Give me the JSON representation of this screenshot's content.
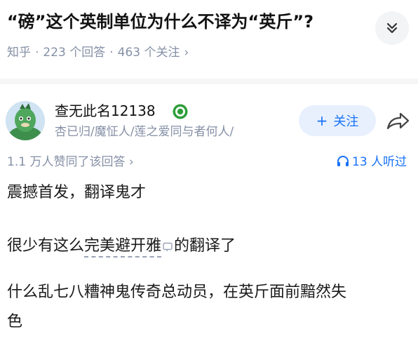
{
  "question": {
    "title": "“磅”这个英制单位为什么不译为“英斤”?",
    "platform": "知乎",
    "answers_count": "223 个回答",
    "followers_count": "463 个关注",
    "separator": "·",
    "arrow": "›"
  },
  "icons": {
    "collapse": "chevron-double-down-icon",
    "badge": "badge-icon",
    "share": "share-icon",
    "headphones": "headphones-icon",
    "comment": "comment-icon"
  },
  "author": {
    "name": "查无此名12138",
    "bio": "杏已归/魔怔人/莲之爱同与者何人/",
    "follow_plus": "+",
    "follow_label": "关注"
  },
  "stats": {
    "votes": "1.1 万人赞同了该回答",
    "votes_arrow": "›",
    "listeners": "13 人听过"
  },
  "answer": {
    "p1": "震撼首发，翻译鬼才",
    "p2_before": "很少有这么",
    "p2_link": "完美避开雅",
    "p2_after": "的翻译了",
    "p3_line1": "什么乱七八糟神鬼传奇总动员，在英斤面前黯然失",
    "p3_line2": "色"
  },
  "colors": {
    "accent": "#1772f6",
    "muted": "#8590a6",
    "follow_bg": "#e8f0fe",
    "badge": "#2e9e3a"
  }
}
